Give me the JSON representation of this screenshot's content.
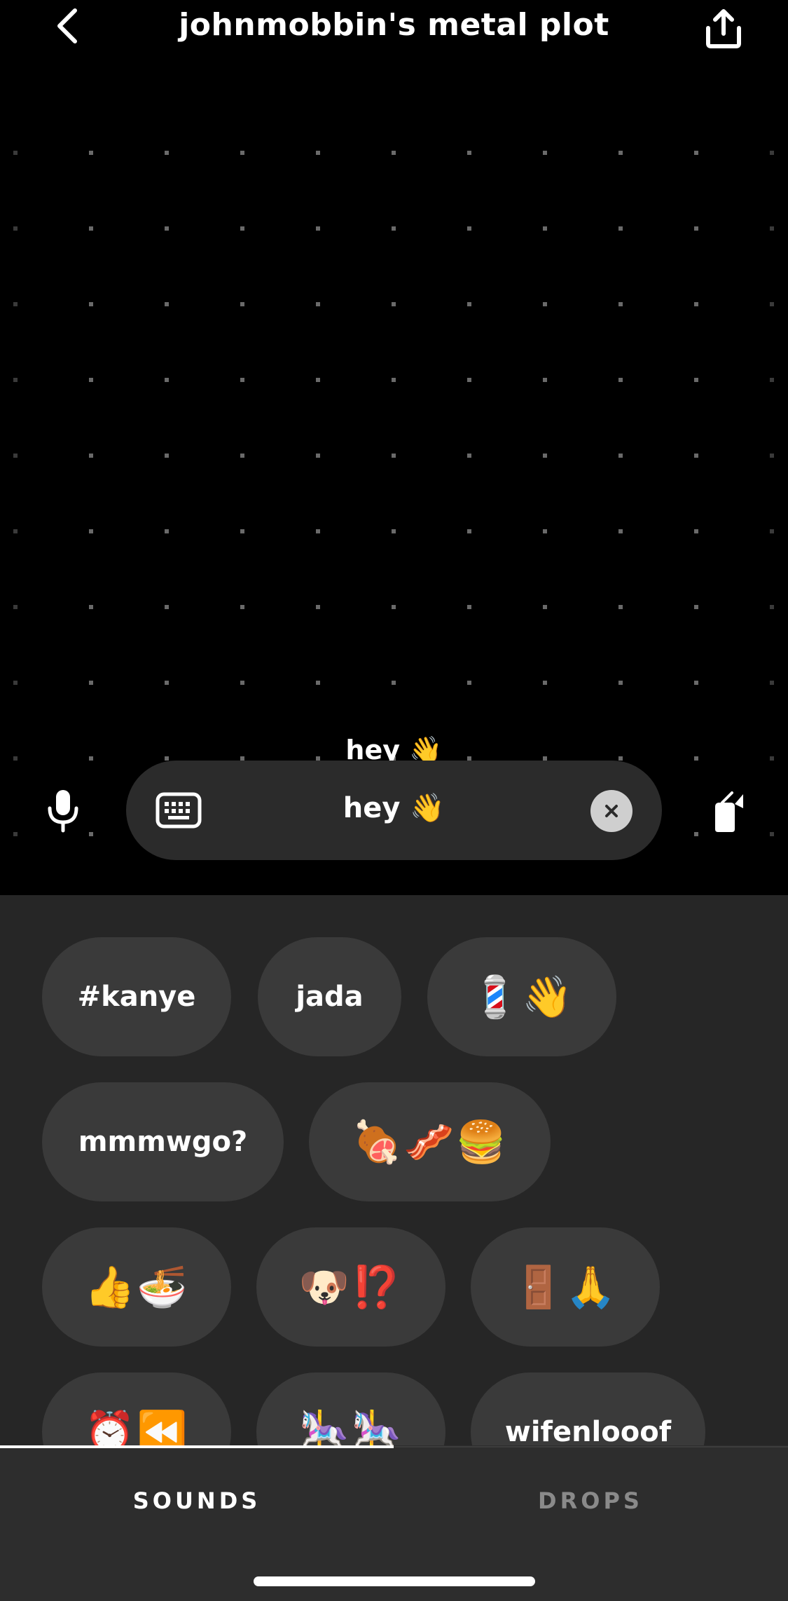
{
  "header": {
    "title": "johnmobbin's metal plot",
    "back_icon": "chevron-left-icon",
    "share_icon": "share-upload-icon"
  },
  "plot": {
    "avatar_label": "hey 👋"
  },
  "composer": {
    "text": "hey 👋",
    "mic_icon": "microphone-icon",
    "keyboard_icon": "keyboard-icon",
    "clear_icon": "clear-icon",
    "camera_icon": "camera-flip-icon"
  },
  "sounds": [
    "#kanye",
    "jada",
    "💈👋",
    "mmmwgo?",
    "🍖🥓🍔",
    "👍🍜",
    "🐶⁉️",
    "🚪🙏",
    "⏰⏪",
    "🎠🎠",
    "wifenlooof"
  ],
  "tabs": {
    "sounds": "SOUNDS",
    "drops": "DROPS",
    "active": "sounds"
  },
  "colors": {
    "background": "#000000",
    "panel": "#262626",
    "chip": "#3a3a3a",
    "composer": "#2b2b2b"
  }
}
